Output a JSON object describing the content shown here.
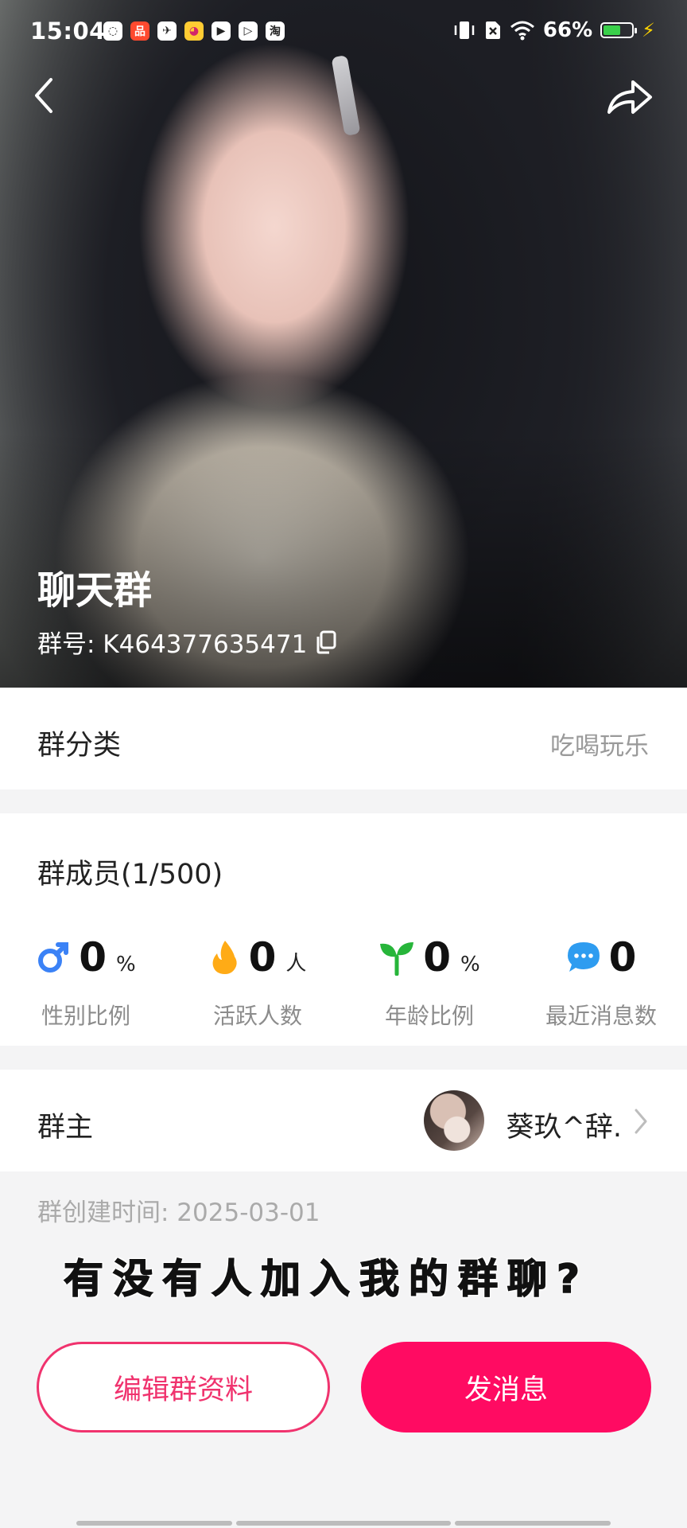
{
  "status_bar": {
    "time": "15:04",
    "battery": "66%",
    "app_badges": [
      "◌",
      "品",
      "✈",
      "◕",
      "▶",
      "▷",
      "淘"
    ]
  },
  "icons": {
    "back": "chevron-left-icon",
    "share": "share-arrow-icon",
    "copy": "copy-icon",
    "male": "male-icon",
    "fire": "fire-icon",
    "sprout": "sprout-icon",
    "chat": "chat-bubble-icon"
  },
  "group": {
    "name": "聊天群",
    "id_label": "群号: K464377635471"
  },
  "category": {
    "label": "群分类",
    "value": "吃喝玩乐"
  },
  "members": {
    "title": "群成员(1/500)",
    "stats": [
      {
        "value": "0",
        "unit": "%",
        "label": "性别比例",
        "icon": "male-icon",
        "color": "#3b82f6"
      },
      {
        "value": "0",
        "unit": "人",
        "label": "活跃人数",
        "icon": "fire-icon",
        "color": "#ffab16"
      },
      {
        "value": "0",
        "unit": "%",
        "label": "年龄比例",
        "icon": "sprout-icon",
        "color": "#27b53a"
      },
      {
        "value": "0",
        "unit": "",
        "label": "最近消息数",
        "icon": "chat-bubble-icon",
        "color": "#2e9cf0"
      }
    ]
  },
  "owner": {
    "label": "群主",
    "name": "葵玖^辞."
  },
  "created": "群创建时间: 2025-03-01",
  "overlay_caption": "有没有人加入我的群聊?",
  "buttons": {
    "edit": "编辑群资料",
    "send": "发消息"
  },
  "colors": {
    "accent": "#ff0b62",
    "accent_border": "#f0336e"
  }
}
